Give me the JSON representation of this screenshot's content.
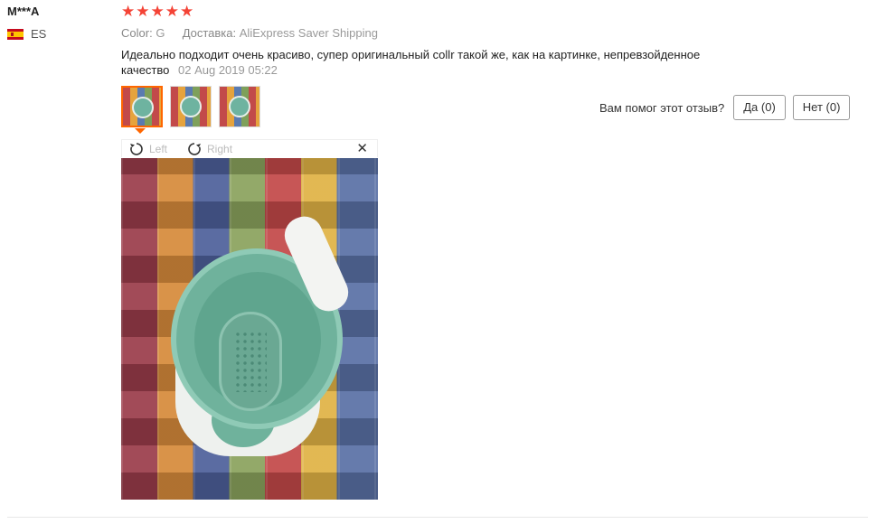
{
  "user": {
    "name": "M***A",
    "country": "ES"
  },
  "review": {
    "stars": "★★★★★",
    "color_label": "Color:",
    "color_value": "G",
    "shipping_label": "Доставка:",
    "shipping_value": "AliExpress Saver Shipping",
    "text": "Идеально подходит очень красиво, супер оригинальный collr такой же, как на картинке, непревзойденное качество",
    "date": "02 Aug 2019 05:22"
  },
  "viewer": {
    "rotate_left": "Left",
    "rotate_right": "Right",
    "close": "✕"
  },
  "vote": {
    "question": "Вам помог этот отзыв?",
    "yes": "Да (0)",
    "no": "Нет (0)"
  },
  "colors": {
    "stars": "#f44336",
    "active_thumb": "#ff6600"
  }
}
